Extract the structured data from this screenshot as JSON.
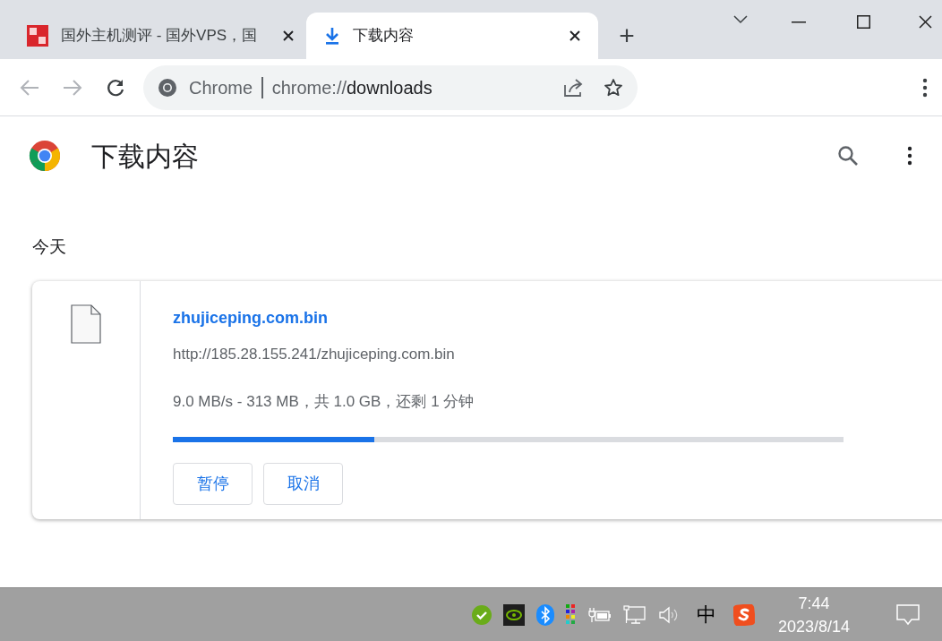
{
  "tabs": [
    {
      "title": "国外主机测评 - 国外VPS，国",
      "selected": false,
      "kind": "site"
    },
    {
      "title": "下载内容",
      "selected": true,
      "kind": "download"
    }
  ],
  "new_tab": "+",
  "address_bar": {
    "label": "Chrome",
    "url_prefix": "chrome://",
    "url_path": "downloads"
  },
  "page": {
    "title": "下载内容",
    "section": "今天"
  },
  "downloads": [
    {
      "file_name": "zhujiceping.com.bin",
      "url": "http://185.28.155.241/zhujiceping.com.bin",
      "status": "9.0 MB/s - 313 MB，共 1.0 GB，还剩 1 分钟",
      "level": 0.3,
      "buttons": [
        "暂停",
        "取消"
      ]
    }
  ],
  "taskbar": {
    "ime": "中",
    "time": "7:44",
    "date": "2023/8/14"
  }
}
